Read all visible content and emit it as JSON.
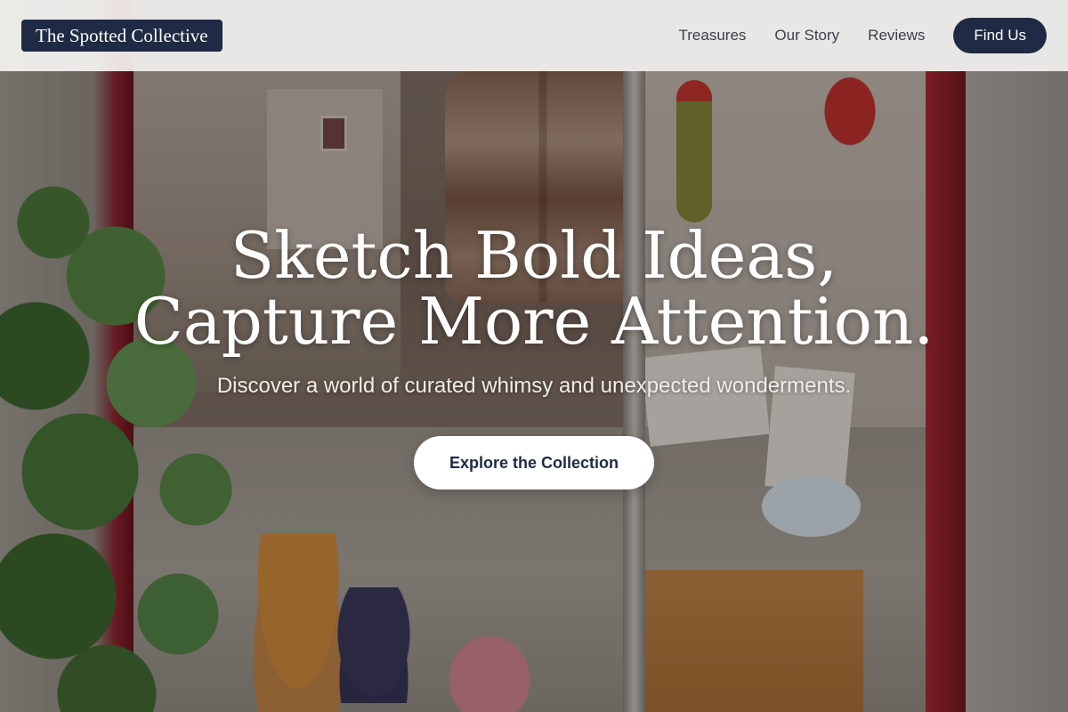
{
  "header": {
    "logo": "The Spotted Collective",
    "nav": [
      "Treasures",
      "Our Story",
      "Reviews"
    ],
    "cta": "Find Us"
  },
  "hero": {
    "title_line1": "Sketch Bold Ideas,",
    "title_line2": "Capture More Attention.",
    "subtitle": "Discover a world of curated whimsy and unexpected wonderments.",
    "button": "Explore the Collection"
  },
  "colors": {
    "brand_navy": "#1f2a44",
    "header_bg": "#f5f4f2",
    "hero_text": "#ffffff"
  }
}
